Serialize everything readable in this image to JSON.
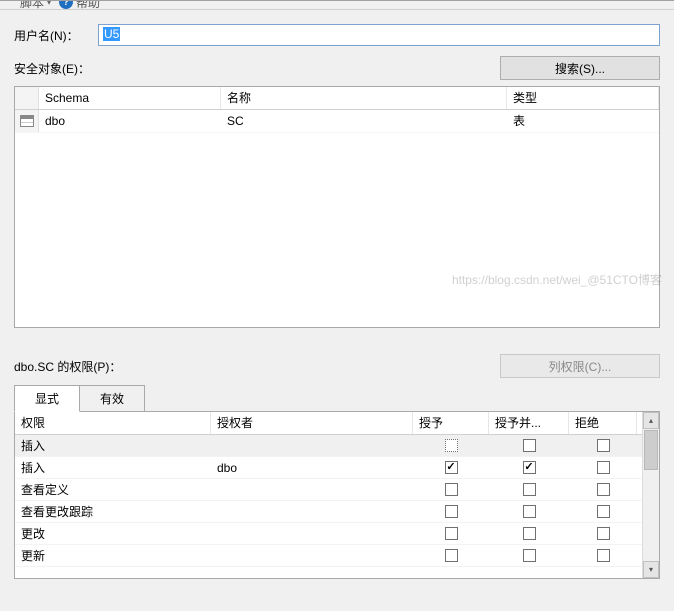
{
  "toolbar": {
    "script_label": "脚本",
    "help_label": "帮助"
  },
  "form": {
    "username_label": "用户名(N)：",
    "username_value": "U5",
    "securables_label": "安全对象(E)：",
    "search_btn": "搜索(S)..."
  },
  "securables_grid": {
    "headers": {
      "schema": "Schema",
      "name": "名称",
      "type": "类型"
    },
    "rows": [
      {
        "schema": "dbo",
        "name": "SC",
        "type": "表"
      }
    ]
  },
  "permissions": {
    "label": "dbo.SC 的权限(P)：",
    "column_perm_btn": "列权限(C)...",
    "tabs": {
      "explicit": "显式",
      "effective": "有效"
    },
    "headers": {
      "permission": "权限",
      "grantor": "授权者",
      "grant": "授予",
      "with_grant": "授予并...",
      "deny": "拒绝"
    },
    "rows": [
      {
        "permission": "插入",
        "grantor": "",
        "grant": false,
        "grant_dotted": true,
        "with_grant": false,
        "deny": false,
        "selected": true
      },
      {
        "permission": "插入",
        "grantor": "dbo",
        "grant": true,
        "with_grant": true,
        "deny": false
      },
      {
        "permission": "查看定义",
        "grantor": "",
        "grant": false,
        "with_grant": false,
        "deny": false
      },
      {
        "permission": "查看更改跟踪",
        "grantor": "",
        "grant": false,
        "with_grant": false,
        "deny": false
      },
      {
        "permission": "更改",
        "grantor": "",
        "grant": false,
        "with_grant": false,
        "deny": false
      },
      {
        "permission": "更新",
        "grantor": "",
        "grant": false,
        "with_grant": false,
        "deny": false
      }
    ]
  },
  "watermark": "https://blog.csdn.net/wei_@51CTO博客"
}
